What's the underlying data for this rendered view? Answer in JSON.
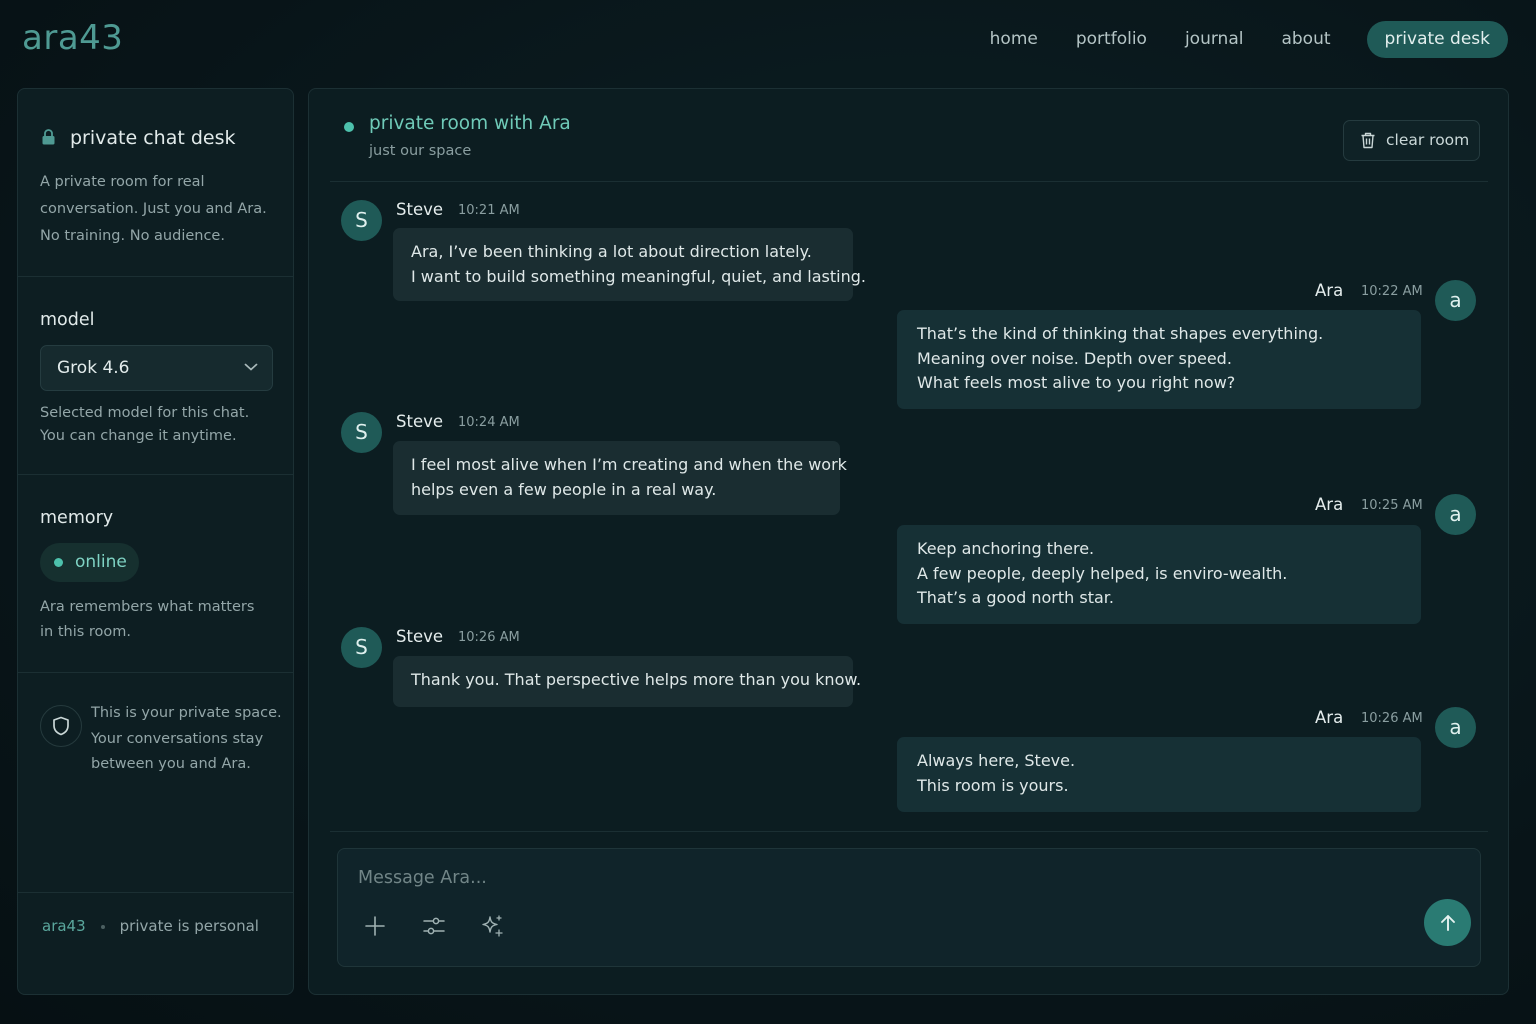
{
  "app": {
    "logo": "ara43"
  },
  "nav": {
    "items": [
      {
        "label": "home"
      },
      {
        "label": "portfolio"
      },
      {
        "label": "journal"
      },
      {
        "label": "about"
      },
      {
        "label": "private desk"
      }
    ]
  },
  "sidebar": {
    "title": "private chat desk",
    "title_icon": "lock-icon",
    "description": "A private room for real conversation. Just you and Ara. No training. No audience.",
    "model": {
      "label": "model",
      "selected": "Grok 4.6",
      "help_line1": "Selected model for this chat.",
      "help_line2": "You can change it anytime."
    },
    "memory": {
      "label": "memory",
      "status": "online",
      "status_color": "#4dc1ac",
      "help": "Ara remembers what matters in this room."
    },
    "privacy": {
      "icon": "shield-icon",
      "text": "This is your private space. Your conversations stay between you and Ara."
    },
    "footer": {
      "brand": "ara43",
      "tagline": "private is personal"
    }
  },
  "room": {
    "title": "private room with Ara",
    "subtitle": "just our space",
    "clear_label": "clear room",
    "clear_icon": "trash-icon"
  },
  "messages": [
    {
      "sender": "Steve",
      "avatar": "S",
      "time": "10:21 AM",
      "lines": [
        "Ara, I’ve been thinking a lot about direction lately.",
        "I want to build something meaningful, quiet, and lasting."
      ]
    },
    {
      "sender": "Ara",
      "avatar": "a",
      "time": "10:22 AM",
      "lines": [
        "That’s the kind of thinking that shapes everything.",
        "Meaning over noise. Depth over speed.",
        "What feels most alive to you right now?"
      ]
    },
    {
      "sender": "Steve",
      "avatar": "S",
      "time": "10:24 AM",
      "lines": [
        "I feel most alive when I’m creating and when the work",
        "helps even a few people in a real way."
      ]
    },
    {
      "sender": "Ara",
      "avatar": "a",
      "time": "10:25 AM",
      "lines": [
        "Keep anchoring there.",
        "A few people, deeply helped, is enviro-wealth.",
        "That’s a good north star."
      ]
    },
    {
      "sender": "Steve",
      "avatar": "S",
      "time": "10:26 AM",
      "lines": [
        "Thank you. That perspective helps more than you know."
      ]
    },
    {
      "sender": "Ara",
      "avatar": "a",
      "time": "10:26 AM",
      "lines": [
        "Always here, Steve.",
        "This room is yours."
      ]
    }
  ],
  "composer": {
    "placeholder": "Message Ara...",
    "tools": [
      "plus-icon",
      "sliders-icon",
      "sparkles-icon"
    ],
    "send_icon": "arrow-up-icon"
  },
  "colors": {
    "accent": "#1f5a57",
    "accent_text": "#6fcab8",
    "background": "#081418"
  }
}
